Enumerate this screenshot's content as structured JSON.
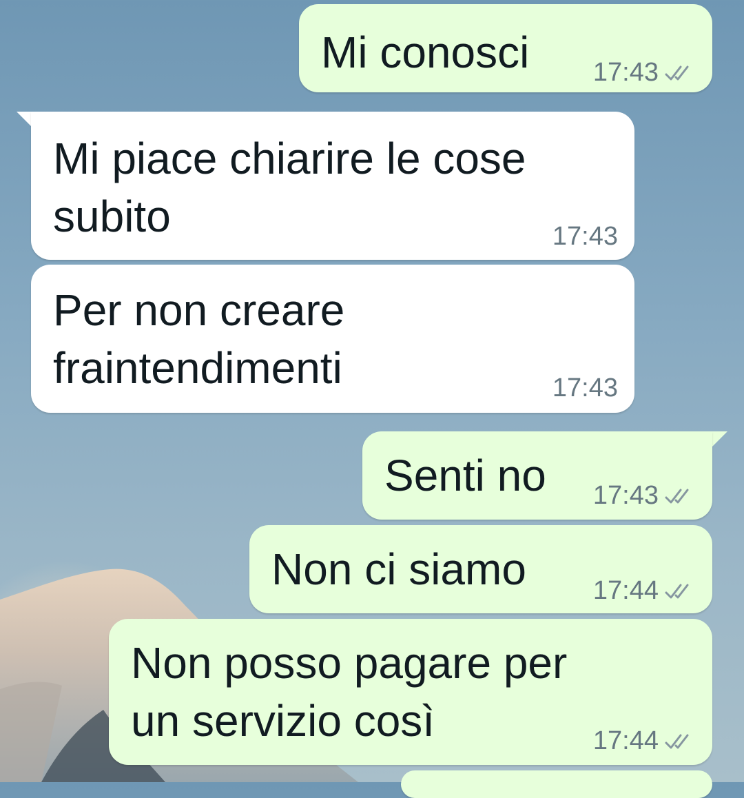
{
  "messages": [
    {
      "id": "m1",
      "direction": "outgoing",
      "text_lines": [
        "Mi conosci"
      ],
      "time": "17:43",
      "status": "read"
    },
    {
      "id": "m2",
      "direction": "incoming",
      "text_lines": [
        "Mi piace chiarire le cose",
        "subito"
      ],
      "time": "17:43"
    },
    {
      "id": "m3",
      "direction": "incoming",
      "text_lines": [
        "Per non creare",
        "fraintendimenti"
      ],
      "time": "17:43"
    },
    {
      "id": "m4",
      "direction": "outgoing",
      "text_lines": [
        "Senti no"
      ],
      "time": "17:43",
      "status": "read"
    },
    {
      "id": "m5",
      "direction": "outgoing",
      "text_lines": [
        "Non ci siamo"
      ],
      "time": "17:44",
      "status": "read"
    },
    {
      "id": "m6",
      "direction": "outgoing",
      "text_lines": [
        "Non posso pagare per",
        "un servizio così"
      ],
      "time": "17:44",
      "status": "read"
    }
  ],
  "colors": {
    "incoming_bubble": "#ffffff",
    "outgoing_bubble": "#e7ffdb",
    "text": "#111b21",
    "meta_text": "#667781"
  },
  "icons": {
    "status_read": "double-check-icon"
  }
}
